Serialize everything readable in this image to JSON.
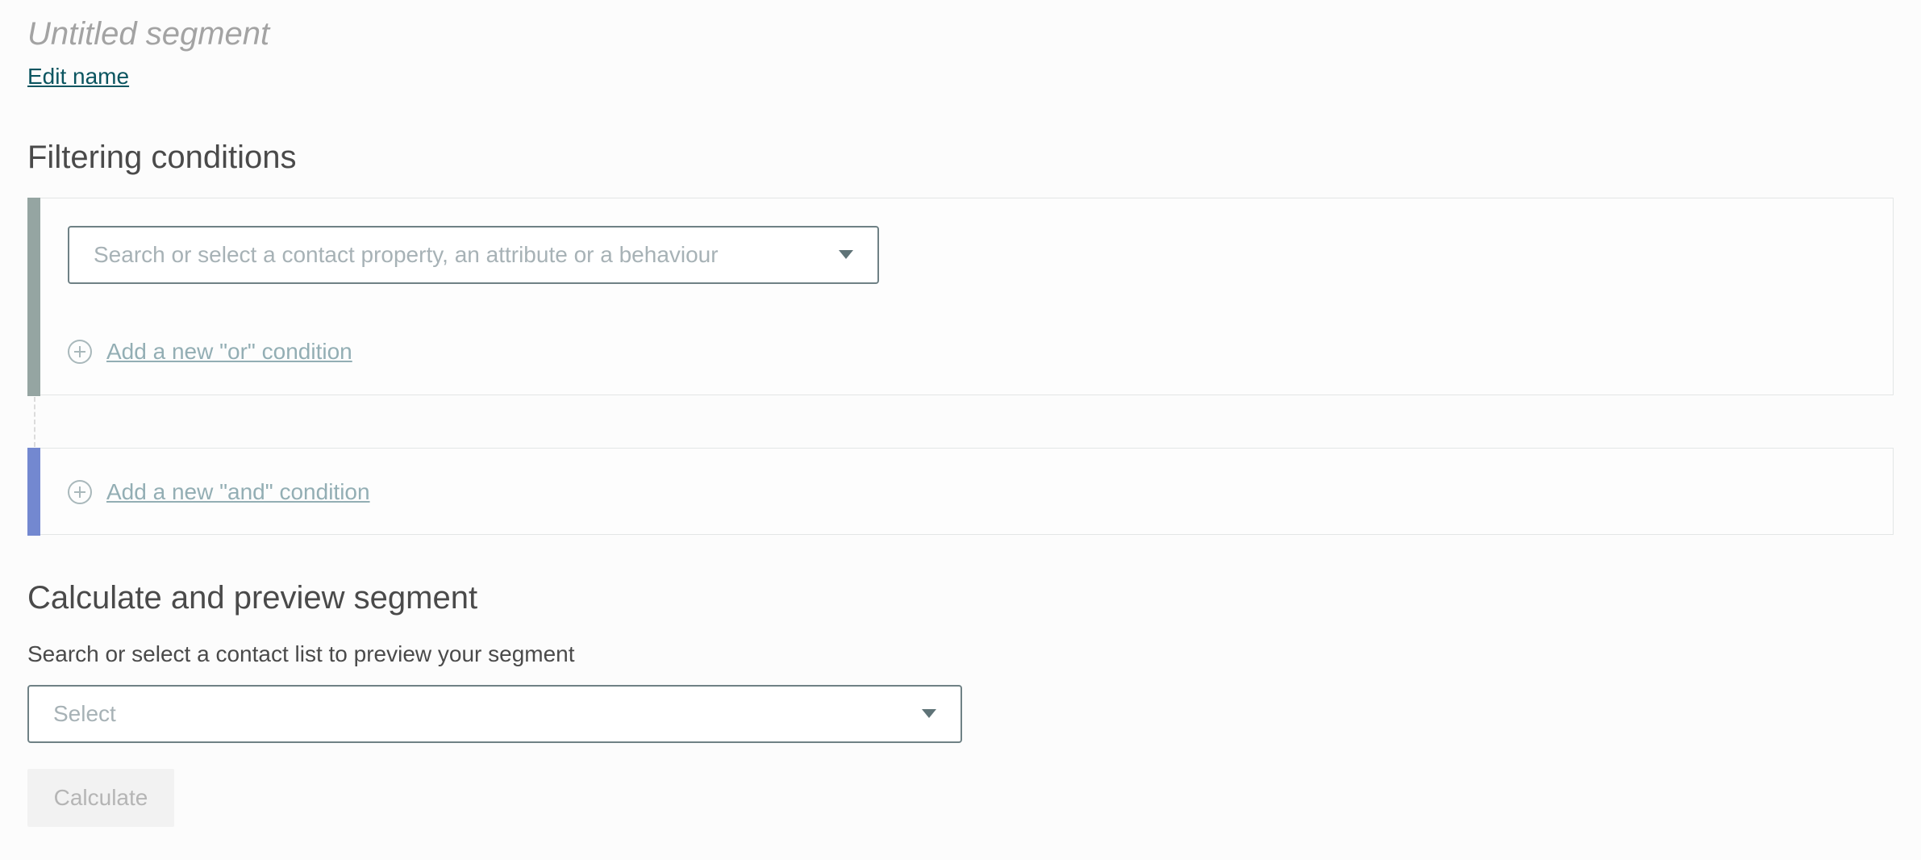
{
  "segment": {
    "title": "Untitled segment",
    "edit_name_label": "Edit name"
  },
  "filtering": {
    "heading": "Filtering conditions",
    "property_select_placeholder": "Search or select a contact property, an attribute or a behaviour",
    "add_or_label": "Add a new \"or\" condition",
    "add_and_label": "Add a new \"and\" condition",
    "colors": {
      "or_bar": "#95a5a2",
      "and_bar": "#7388d0"
    }
  },
  "calculate": {
    "heading": "Calculate and preview segment",
    "list_label": "Search or select a contact list to preview your segment",
    "list_select_placeholder": "Select",
    "button_label": "Calculate"
  },
  "icons": {
    "plus": "plus-circle-icon",
    "caret": "chevron-down-icon"
  }
}
